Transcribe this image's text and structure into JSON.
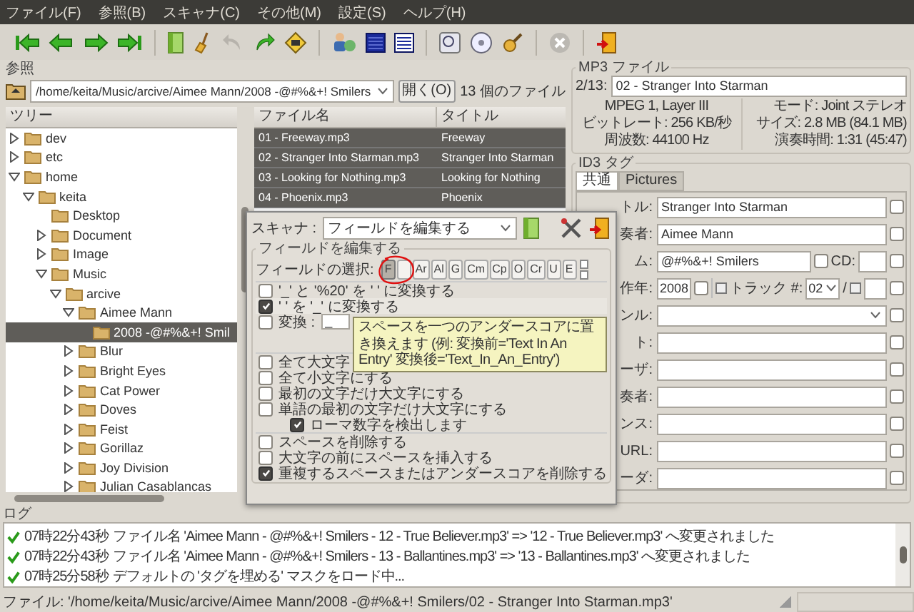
{
  "menu": [
    "ファイル(F)",
    "参照(B)",
    "スキャナ(C)",
    "その他(M)",
    "設定(S)",
    "ヘルプ(H)"
  ],
  "browser": {
    "title": "参照",
    "path": "/home/keita/Music/arcive/Aimee Mann/2008 -@#%&+! Smilers",
    "open_button": "開く(O)",
    "file_count": "13 個のファイル"
  },
  "tree": {
    "header": "ツリー",
    "items": [
      {
        "label": "dev",
        "expanded": false,
        "selected": false
      },
      {
        "label": "etc",
        "expanded": false,
        "selected": false
      },
      {
        "label": "home",
        "expanded": true,
        "selected": false,
        "children": [
          {
            "label": "keita",
            "expanded": true,
            "selected": false,
            "children": [
              {
                "label": "Desktop",
                "selected": false
              },
              {
                "label": "Document",
                "expanded": false,
                "selected": false
              },
              {
                "label": "Image",
                "expanded": false,
                "selected": false
              },
              {
                "label": "Music",
                "expanded": true,
                "selected": false,
                "children": [
                  {
                    "label": "arcive",
                    "expanded": true,
                    "selected": false,
                    "children": [
                      {
                        "label": "Aimee Mann",
                        "expanded": true,
                        "selected": false,
                        "children": [
                          {
                            "label": "2008 -@#%&+! Smil",
                            "selected": true
                          }
                        ]
                      },
                      {
                        "label": "Blur",
                        "expanded": false,
                        "selected": false
                      },
                      {
                        "label": "Bright Eyes",
                        "expanded": false,
                        "selected": false
                      },
                      {
                        "label": "Cat Power",
                        "expanded": false,
                        "selected": false
                      },
                      {
                        "label": "Doves",
                        "expanded": false,
                        "selected": false
                      },
                      {
                        "label": "Feist",
                        "expanded": false,
                        "selected": false
                      },
                      {
                        "label": "Gorillaz",
                        "expanded": false,
                        "selected": false
                      },
                      {
                        "label": "Joy Division",
                        "expanded": false,
                        "selected": false
                      },
                      {
                        "label": "Julian Casablancas",
                        "expanded": false,
                        "selected": false
                      }
                    ]
                  }
                ]
              }
            ]
          }
        ]
      }
    ]
  },
  "file_list": {
    "columns": [
      "ファイル名",
      "タイトル"
    ],
    "rows": [
      {
        "filename": "01 - Freeway.mp3",
        "title": "Freeway",
        "selected": true
      },
      {
        "filename": "02 - Stranger Into Starman.mp3",
        "title": "Stranger Into Starman",
        "selected": true
      },
      {
        "filename": "03 - Looking for Nothing.mp3",
        "title": "Looking for Nothing",
        "selected": true
      },
      {
        "filename": "04 - Phoenix.mp3",
        "title": "Phoenix",
        "selected": true
      }
    ]
  },
  "mp3_file": {
    "title": "MP3 ファイル",
    "position": "2/13:",
    "name": "02 - Stranger Into Starman",
    "info_left": [
      "MPEG 1, Layer III",
      "ビットレート: 256 KB/秒",
      "周波数: 44100 Hz"
    ],
    "info_right": [
      "モード: Joint ステレオ",
      "サイズ: 2.8 MB (84.1 MB)",
      "演奏時間: 1:31 (45:47)"
    ]
  },
  "id3_tag": {
    "title": "ID3 タグ",
    "tabs": [
      {
        "label": "共通",
        "selected": true
      },
      {
        "label": "Pictures",
        "selected": false
      }
    ],
    "fields": [
      {
        "kind": "text",
        "label": "トル:",
        "value": "Stranger Into Starman",
        "checked": false
      },
      {
        "kind": "text",
        "label": "奏者:",
        "value": "Aimee Mann",
        "checked": false
      },
      {
        "kind": "album",
        "label": "ム:",
        "value": "@#%&+! Smilers",
        "inner_checked": false,
        "cd_label": "CD:",
        "checked": false
      },
      {
        "kind": "year",
        "label": "作年:",
        "value": "2008",
        "inner_checked": false,
        "track_label": "トラック #:",
        "track": "02",
        "separator": "/",
        "checked": false
      },
      {
        "kind": "combo",
        "label": "ンル:",
        "checked": false
      },
      {
        "kind": "text",
        "label": "ト:",
        "checked": false
      },
      {
        "kind": "text",
        "label": "ーザ:",
        "checked": false
      },
      {
        "kind": "text",
        "label": "奏者:",
        "checked": false
      },
      {
        "kind": "text",
        "label": "ンス:",
        "checked": false
      },
      {
        "kind": "text",
        "label": "URL:",
        "checked": false
      },
      {
        "kind": "text",
        "label": "ーダ:",
        "checked": false
      }
    ]
  },
  "scanner": {
    "scanner_label": "スキャナ :",
    "mode": "フィールドを編集する",
    "frame_title": "フィールドを編集する",
    "field_label": "フィールドの選択:",
    "field_buttons": [
      {
        "label": "F",
        "selected": true
      },
      {
        "selected": false
      },
      {
        "label": "Ar",
        "selected": false
      },
      {
        "label": "Al",
        "selected": false
      },
      {
        "label": "G",
        "selected": false
      },
      {
        "label": "Cm",
        "selected": false
      },
      {
        "label": "Cp",
        "selected": false
      },
      {
        "label": "O",
        "selected": false
      },
      {
        "label": "Cr",
        "selected": false
      },
      {
        "label": "U",
        "selected": false
      },
      {
        "label": "E",
        "selected": false
      }
    ],
    "groups": [
      [
        {
          "kind": "check",
          "label": "'_' と '%20' を ' ' に変換する",
          "checked": false
        },
        {
          "kind": "check",
          "label": "' ' を '_' に変換する",
          "checked": true
        },
        {
          "kind": "convert",
          "label": "変換 :",
          "value": "_",
          "checked": false
        }
      ],
      [
        {
          "kind": "check",
          "label": "全て大文字",
          "checked": false
        },
        {
          "kind": "check",
          "label": "全て小文字にする",
          "checked": false
        },
        {
          "kind": "check",
          "label": "最初の文字だけ大文字にする",
          "checked": false
        },
        {
          "kind": "pair",
          "label": "単語の最初の文字だけ大文字にする",
          "checked": false,
          "extra_label": "ローマ数字を検出します",
          "extra_checked": true
        }
      ],
      [
        {
          "kind": "check",
          "label": "スペースを削除する",
          "checked": false
        },
        {
          "kind": "check",
          "label": "大文字の前にスペースを挿入する",
          "checked": false
        },
        {
          "kind": "check",
          "label": "重複するスペースまたはアンダースコアを削除する",
          "checked": true
        }
      ]
    ],
    "tooltip": "スペースを一つのアンダースコアに置き換えます (例: 変換前='Text In An Entry' 変換後='Text_In_An_Entry')"
  },
  "log": {
    "title": "ログ",
    "entries": [
      {
        "time": "07時22分43秒",
        "message": "ファイル名 'Aimee Mann - @#%&+! Smilers - 12 - True Believer.mp3' => '12 - True Believer.mp3' へ変更されました"
      },
      {
        "time": "07時22分43秒",
        "message": "ファイル名 'Aimee Mann - @#%&+! Smilers - 13 - Ballantines.mp3' => '13 - Ballantines.mp3' へ変更されました"
      },
      {
        "time": "07時25分58秒",
        "message": "デフォルトの 'タグを埋める' マスクをロード中..."
      }
    ]
  },
  "status_bar": "ファイル: '/home/keita/Music/arcive/Aimee Mann/2008 -@#%&+! Smilers/02 - Stranger Into Starman.mp3'"
}
